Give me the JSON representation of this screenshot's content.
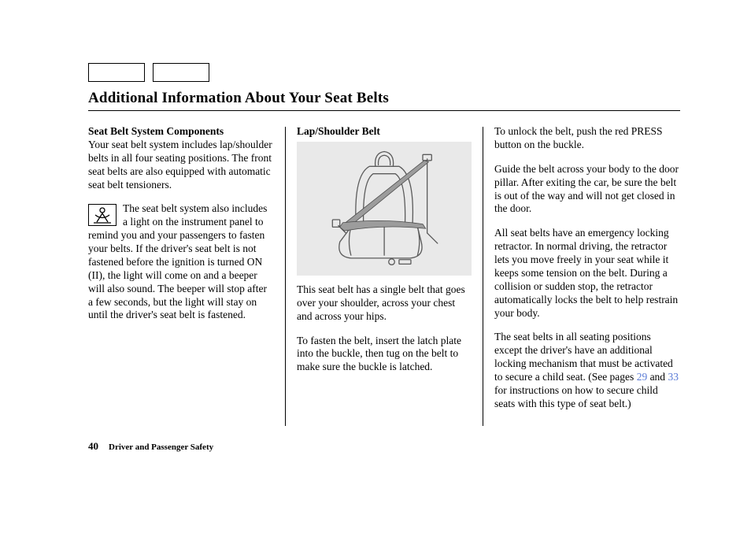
{
  "header": {
    "title": "Additional Information About Your Seat Belts"
  },
  "column1": {
    "heading": "Seat Belt System Components",
    "p1": "Your seat belt system includes lap/shoulder belts in all four seating positions. The front seat belts are also equipped with automatic seat belt tensioners.",
    "p2": "The seat belt system also includes a light on the instrument panel to remind you and your passengers to fasten your belts. If the driver's seat belt is not fastened before the ignition is turned ON (II), the light will come on and a beeper will also sound. The beeper will stop after a few seconds, but the light will stay on until the driver's seat belt is fastened."
  },
  "column2": {
    "heading": "Lap/Shoulder Belt",
    "p1": "This seat belt has a single belt that goes over your shoulder, across your chest and across your hips.",
    "p2": "To fasten the belt, insert the latch plate into the buckle, then tug on the belt to make sure the buckle is latched."
  },
  "column3": {
    "p1": "To unlock the belt, push the red PRESS button on the buckle.",
    "p2": "Guide the belt across your body to the door pillar. After exiting the car, be sure the belt is out of the way and will not get closed in the door.",
    "p3": "All seat belts have an emergency locking retractor. In normal driving, the retractor lets you move freely in your seat while it keeps some tension on the belt. During a collision or sudden stop, the retractor automatically locks the belt to help restrain your body.",
    "p4a": "The seat belts in all seating positions except the driver's have an additional locking mechanism that must be activated to secure a child seat. (See pages ",
    "link1": "29",
    "p4b": " and ",
    "link2": "33",
    "p4c": " for instructions on how to secure child seats with this type of seat belt.)"
  },
  "footer": {
    "page_number": "40",
    "section_label": "Driver and Passenger Safety"
  }
}
